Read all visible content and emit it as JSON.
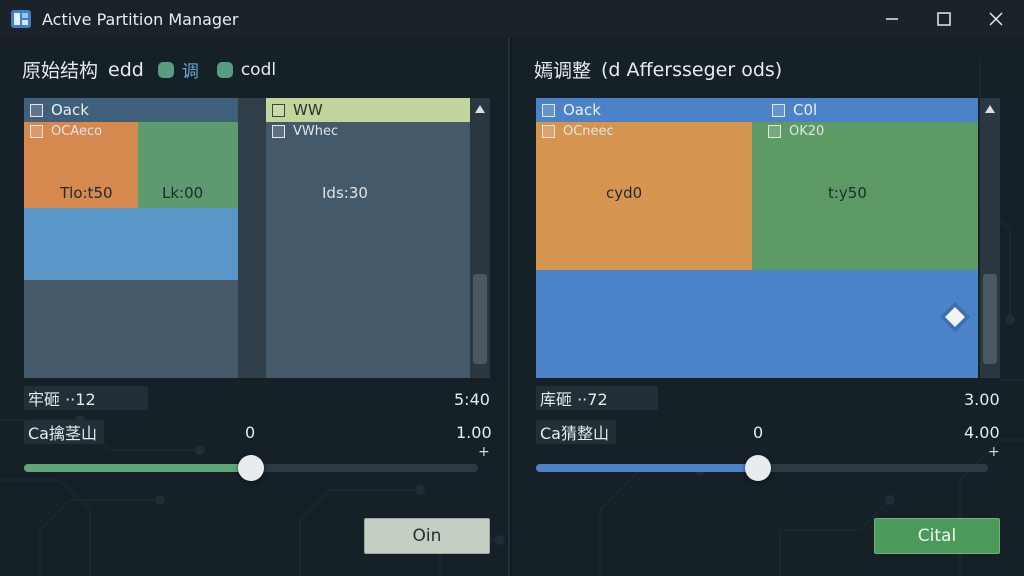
{
  "window": {
    "title": "Active Partition Manager",
    "controls": [
      "minimize-icon",
      "maximize-icon",
      "close-icon"
    ]
  },
  "colors": {
    "orange": "#d6894f",
    "green": "#5e9a70",
    "blue": "#5b96c8",
    "slate": "#44596a",
    "accent_green": "#4b9a5b",
    "accent_blue": "#4b82c8",
    "light_green": "#c2d59c"
  },
  "left": {
    "heading": "原始结构",
    "heading_extra": "edd",
    "legend": [
      {
        "label": "调",
        "color": "#5a9c82"
      },
      {
        "label": "codl",
        "color": "#5a9c82"
      }
    ],
    "blocks": {
      "a_head": "Oack",
      "a_sub": "OCAeco",
      "a_val": "Tlo:t50",
      "b_val": "Lk:00",
      "c_head": "WW",
      "c_sub": "VWhec",
      "c_val": "Ids:30"
    },
    "info_label": "牢砸 ··12",
    "info_value": "5:40",
    "slider_label": "Ca擒茎山",
    "slider_min": "0",
    "slider_max": "1.00",
    "slider_plus": "+",
    "slider_level": 0.5,
    "button": "Oin"
  },
  "right": {
    "heading": "嫣调整",
    "heading_extra": "(d Affersseger ods)",
    "blocks": {
      "a_head": "Oack",
      "a_sub": "OCneec",
      "a_val": "cyd0",
      "b_head": "C0l",
      "b_sub": "OK20",
      "b_val": "t:y50"
    },
    "info_label": "库砸 ··72",
    "info_value": "3.00",
    "slider_label": "Ca猜整山",
    "slider_min": "0",
    "slider_max": "4.00",
    "slider_plus": "+",
    "slider_level": 0.5,
    "button": "Cital"
  }
}
